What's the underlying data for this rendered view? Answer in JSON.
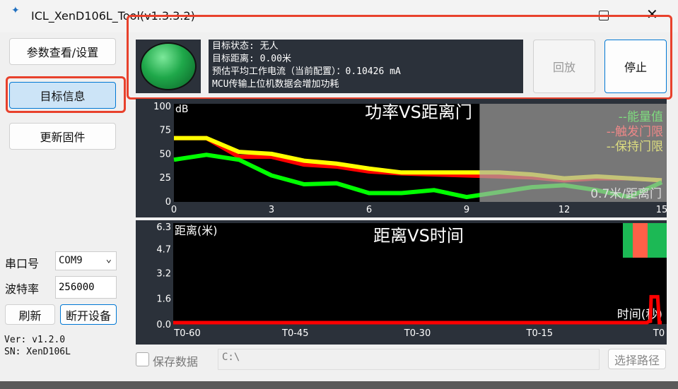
{
  "window": {
    "title": "ICL_XenD106L_Tool(v1.3.3.2)",
    "logo_text": "ICL",
    "maximize_icon": "square",
    "close_icon": "x"
  },
  "sidebar": {
    "params_button": "参数查看/设置",
    "target_info_button": "目标信息",
    "update_fw_button": "更新固件",
    "port_label": "串口号",
    "port_value": "COM9",
    "baud_label": "波特率",
    "baud_value": "256000",
    "refresh_button": "刷新",
    "disconnect_button": "断开设备",
    "version": "Ver: v1.2.0",
    "sn": "SN: XenD106L"
  },
  "status": {
    "lines": [
      "目标状态: 无人",
      "目标距离: 0.00米",
      "预估平均工作电流（当前配置）：0.10426 mA",
      "MCU传输上位机数据会增加功耗"
    ],
    "playback_button": "回放",
    "stop_button": "停止",
    "indicator_color": "#1fa84a"
  },
  "colors": {
    "energy": "#00ff00",
    "trigger": "#ff0000",
    "hold": "#ffff00",
    "highlight": "#e8412c"
  },
  "bottom": {
    "save_label": "保存数据",
    "save_checked": false,
    "path_value": "C:\\",
    "choose_path_button": "选择路径"
  },
  "chart_data": [
    {
      "type": "line",
      "title": "功率VS距离门",
      "ylabel": "dB",
      "xlabel": "0.7米/距离门",
      "xlim": [
        0,
        15
      ],
      "ylim": [
        0,
        100
      ],
      "xticks": [
        "0",
        "3",
        "6",
        "9",
        "12",
        "15"
      ],
      "yticks": [
        "100",
        "75",
        "50",
        "25",
        "0"
      ],
      "x": [
        0,
        1,
        2,
        3,
        4,
        5,
        6,
        7,
        8,
        9,
        10,
        11,
        12,
        13,
        14,
        15
      ],
      "shaded_from": 9.4,
      "legend": [
        "--能量值",
        "--触发门限",
        "--保持门限"
      ],
      "series": [
        {
          "name": "能量值",
          "values": [
            43,
            48,
            43,
            27,
            18,
            19,
            9,
            9,
            12,
            5,
            10,
            15,
            17,
            12,
            5,
            20
          ]
        },
        {
          "name": "触发门限",
          "values": [
            65,
            65,
            46,
            46,
            38,
            36,
            31,
            29,
            28,
            27,
            26,
            25,
            22,
            24,
            24,
            22
          ]
        },
        {
          "name": "保持门限",
          "values": [
            65,
            65,
            51,
            49,
            42,
            39,
            34,
            30,
            30,
            30,
            30,
            28,
            24,
            26,
            24,
            22
          ]
        }
      ]
    },
    {
      "type": "line",
      "title": "距离VS时间",
      "ylabel": "距离(米)",
      "xlabel": "时间(秒)",
      "xlim": [
        -60,
        0
      ],
      "ylim": [
        0,
        6.3
      ],
      "xticks": [
        "T0-60",
        "T0-45",
        "T0-30",
        "T0-15",
        "T0"
      ],
      "yticks": [
        "6.3",
        "4.7",
        "3.2",
        "1.6",
        "0.0"
      ],
      "series": [
        {
          "name": "距离",
          "x": [
            -60,
            -1.8,
            -1.5,
            -1.4,
            -1.3,
            -0.5,
            -0.3,
            -0.2,
            0
          ],
          "values": [
            0,
            0,
            0.2,
            0,
            1.7,
            1.7,
            0,
            0,
            0
          ]
        }
      ]
    }
  ]
}
